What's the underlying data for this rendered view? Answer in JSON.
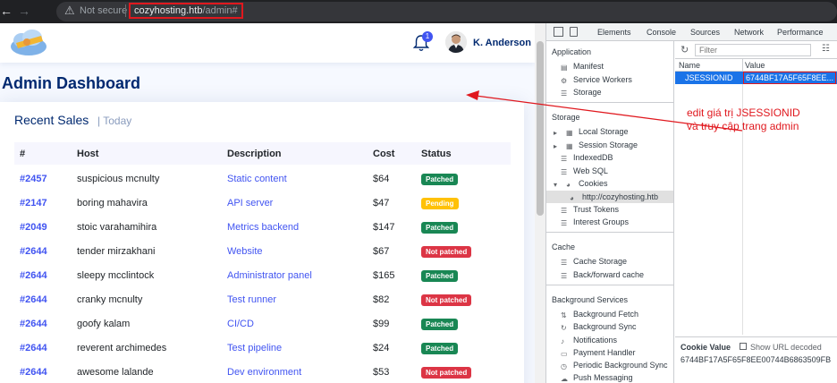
{
  "browser": {
    "security": "Not secure",
    "url_host": "cozyhosting.htb",
    "url_path": "/admin#"
  },
  "header": {
    "notification_count": "1",
    "user_name": "K. Anderson"
  },
  "page_title": "Admin Dashboard",
  "sales": {
    "title": "Recent Sales",
    "subtitle": "Today",
    "columns": [
      "#",
      "Host",
      "Description",
      "Cost",
      "Status"
    ],
    "rows": [
      {
        "id": "#2457",
        "host": "suspicious mcnulty",
        "desc": "Static content",
        "cost": "$64",
        "status": "Patched"
      },
      {
        "id": "#2147",
        "host": "boring mahavira",
        "desc": "API server",
        "cost": "$47",
        "status": "Pending"
      },
      {
        "id": "#2049",
        "host": "stoic varahamihira",
        "desc": "Metrics backend",
        "cost": "$147",
        "status": "Patched"
      },
      {
        "id": "#2644",
        "host": "tender mirzakhani",
        "desc": "Website",
        "cost": "$67",
        "status": "Not patched"
      },
      {
        "id": "#2644",
        "host": "sleepy mcclintock",
        "desc": "Administrator panel",
        "cost": "$165",
        "status": "Patched"
      },
      {
        "id": "#2644",
        "host": "cranky mcnulty",
        "desc": "Test runner",
        "cost": "$82",
        "status": "Not patched"
      },
      {
        "id": "#2644",
        "host": "goofy kalam",
        "desc": "CI/CD",
        "cost": "$99",
        "status": "Patched"
      },
      {
        "id": "#2644",
        "host": "reverent archimedes",
        "desc": "Test pipeline",
        "cost": "$24",
        "status": "Patched"
      },
      {
        "id": "#2644",
        "host": "awesome lalande",
        "desc": "Dev environment",
        "cost": "$53",
        "status": "Not patched"
      }
    ]
  },
  "devtools": {
    "tabs": [
      "Elements",
      "Console",
      "Sources",
      "Network",
      "Performance"
    ],
    "application_section": "Application",
    "application_items": [
      "Manifest",
      "Service Workers",
      "Storage"
    ],
    "storage_section": "Storage",
    "storage_items": [
      "Local Storage",
      "Session Storage",
      "IndexedDB",
      "Web SQL",
      "Cookies"
    ],
    "cookie_origin": "http://cozyhosting.htb",
    "storage_items2": [
      "Trust Tokens",
      "Interest Groups"
    ],
    "cache_section": "Cache",
    "cache_items": [
      "Cache Storage",
      "Back/forward cache"
    ],
    "bg_section": "Background Services",
    "bg_items": [
      "Background Fetch",
      "Background Sync",
      "Notifications",
      "Payment Handler",
      "Periodic Background Sync",
      "Push Messaging"
    ],
    "filter_placeholder": "Filter",
    "col_name": "Name",
    "col_value": "Value",
    "cookie_name": "JSESSIONID",
    "cookie_value_short": "6744BF17A5F65F8EE...",
    "cookie_value_title": "Cookie Value",
    "show_url_decoded": "Show URL decoded",
    "cookie_value_full": "6744BF17A5F65F8EE00744B6863509FB"
  },
  "annotation": {
    "line1": "edit giá trị JSESSIONID",
    "line2": "và truy cập trang admin"
  },
  "colors": {
    "accent": "#4154f1",
    "navy": "#012970",
    "annotation": "#e0181e",
    "patched": "#198754",
    "pending": "#ffc107",
    "not_patched": "#dc3545"
  }
}
